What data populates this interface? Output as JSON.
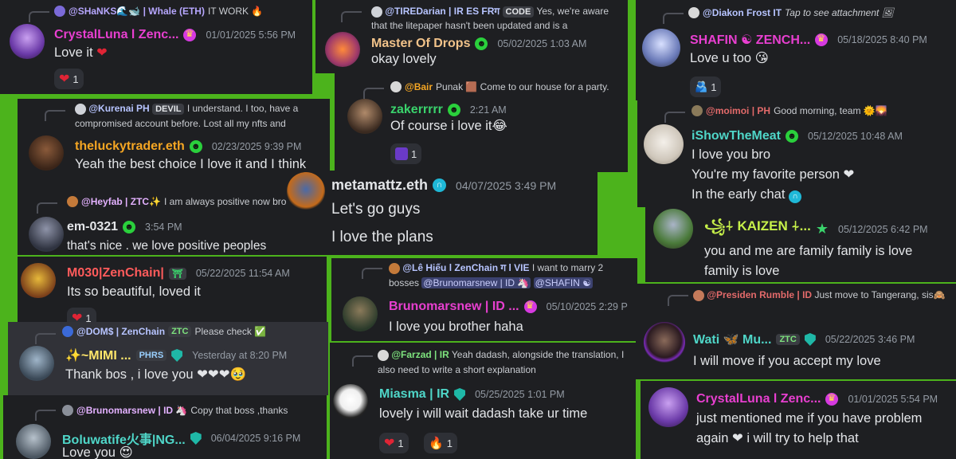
{
  "colors": {
    "background": "#4cb31c",
    "card": "#1e1f22",
    "heart": "#e02435"
  },
  "cards": {
    "c1": {
      "reply": {
        "name": "@SHaNKS🌊🐋 | Whale (ETH)",
        "text": "IT WORK 🔥"
      },
      "author": "CrystalLuna l Zenc...",
      "time": "01/01/2025 5:56 PM",
      "text": "Love it",
      "reaction": {
        "emoji": "❤",
        "count": "1"
      }
    },
    "c2": {
      "reply": {
        "name": "@Kurenai PH",
        "tag": "DEVIL",
        "text": "I understand. I too, have a compromised account before. Lost all my nfts and"
      },
      "author": "theluckytrader.eth",
      "time": "02/23/2025 9:39 PM",
      "text": "Yeah the best choice I love it and I think"
    },
    "c3": {
      "reply": {
        "name": "@Heyfab | ZTC✨",
        "text": "I am always positive now bro"
      },
      "author": "em-0321",
      "time": "3:54 PM",
      "text": "that's nice . we love positive peoples"
    },
    "c4": {
      "author": "M030|ZenChain|",
      "time": "05/22/2025 11:54 AM",
      "text": "Its so beautiful, loved it"
    },
    "c5": {
      "reply": {
        "name": "@DOM$ | ZenChain",
        "tag": "ZTC",
        "text": "Please check ✅"
      },
      "author": "✨~MIMI ...",
      "tag": "PHRS",
      "time": "Yesterday at 8:20 PM",
      "text": "Thank bos , i love you ❤❤❤🥹"
    },
    "c6": {
      "reply": {
        "name": "@Brunomarsnew | ID 🦄",
        "text": "Copy that boss ,thanks"
      },
      "author": "Boluwatife火事|NG...",
      "time": "06/04/2025 9:16 PM",
      "text": "Love you 😍"
    },
    "c7": {
      "reply": {
        "name": "@TIREDarian | IR ES FRग",
        "tag": "CODE",
        "text": "Yes, we're aware that the litepaper hasn't been updated and is a"
      },
      "author": "Master Of Drops",
      "time": "05/02/2025 1:03 AM",
      "text": "okay lovely"
    },
    "c8": {
      "reply": {
        "name": "@Bair",
        "text": "Punak 🟫 Come to our house for a party."
      },
      "author": "zakerrrrr",
      "time": "2:21 AM",
      "text": "Of course i love it😂",
      "reaction": {
        "emoji": "🟪",
        "count": "1"
      }
    },
    "c9": {
      "author": "metamattz.eth",
      "time": "04/07/2025 3:49 PM",
      "line1": "Let's go guys",
      "line2": "I love the plans"
    },
    "c10": {
      "reply": {
        "name": "@Lê Hiếu l ZenChain ग l VIE",
        "text": "I want to marry 2",
        "text2": "bosses",
        "mention1": "@Brunomarsnew | ID 🦄",
        "mention2": "@SHAFIN ☯"
      },
      "author": "Brunomarsnew | ID ...",
      "time": "05/10/2025 2:29 P",
      "text": "I love you brother haha"
    },
    "c11": {
      "reply": {
        "name": "@Farzad | IR",
        "text": "Yeah dadash, alongside the",
        "text2": "translation, I also need to write a short explanation"
      },
      "author": "Miasma | IR",
      "time": "05/25/2025 1:01 PM",
      "text": "lovely i will wait dadash take ur time",
      "reactions": [
        {
          "emoji": "❤",
          "count": "1"
        },
        {
          "emoji": "🔥",
          "count": "1"
        }
      ]
    },
    "c12": {
      "reply": {
        "name": "@Diakon Frost IT",
        "text": "Tap to see attachment 🖼"
      },
      "author": "SHAFIN ☯ ZENCH...",
      "time": "05/18/2025 8:40 PM",
      "text": "Love u too 😘",
      "reaction": {
        "emoji": "🫂",
        "count": "1"
      }
    },
    "c13": {
      "reply": {
        "name": "@moimoi | PH",
        "text": "Good morning, team 🌞🌄"
      },
      "author": "iShowTheMeat",
      "time": "05/12/2025 10:48 AM",
      "line1": "I love you bro",
      "line2": "You're my favorite person ❤",
      "line3": "In the early chat"
    },
    "c14": {
      "author": "꧁⍭ KAIZEN ⍭...",
      "time": "05/12/2025 6:42 PM",
      "line1": "you and me are family family is love",
      "line2": "family is love"
    },
    "c15": {
      "reply": {
        "name": "@Presiden Rumble | ID",
        "text": "Just move to Tangerang,",
        "text2": "sis🙈"
      },
      "author": "Wati 🦋 Mu...",
      "tag": "ZTC",
      "time": "05/22/2025 3:46 PM",
      "text": "I will move if you accept my love"
    },
    "c16": {
      "author": "CrystalLuna l Zenc...",
      "time": "01/01/2025 5:54 PM",
      "line1": "just mentioned me if you have problem",
      "line2": "again ❤ i will try to help that"
    }
  }
}
